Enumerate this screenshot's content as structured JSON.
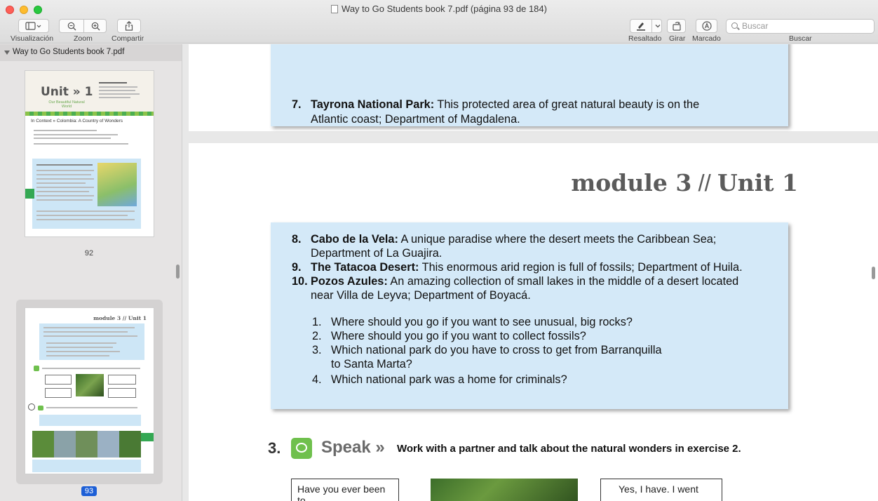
{
  "window": {
    "title": "Way to Go Students book  7.pdf (página 93 de 184)"
  },
  "toolbar": {
    "visualizacion_label": "Visualización",
    "zoom_label": "Zoom",
    "compartir_label": "Compartir",
    "resaltado_label": "Resaltado",
    "girar_label": "Girar",
    "marcado_label": "Marcado",
    "buscar_label": "Buscar",
    "search_placeholder": "Buscar"
  },
  "sidebar": {
    "header": "Way to Go Students book  7.pdf",
    "pages": [
      {
        "number": "92",
        "selected": false,
        "unit_title": "Unit » 1",
        "unit_subtitle": "Our Beautiful Natural World",
        "context": "In Context » Colombia: A Country of Wonders"
      },
      {
        "number": "93",
        "selected": true,
        "module_title": "module 3 // Unit 1"
      }
    ]
  },
  "document": {
    "top_item": {
      "num": "7.",
      "title": "Tayrona National Park:",
      "text": " This protected area of great natural beauty is on the",
      "cont": "Atlantic coast; Department of Magdalena."
    },
    "module_word": "module 3",
    "module_sep": " // ",
    "module_unit": "Unit 1",
    "items": [
      {
        "num": "8.",
        "title": "Cabo de la Vela:",
        "text": " A unique paradise where the desert meets the Caribbean Sea;",
        "cont": "Department of La Guajira."
      },
      {
        "num": "9.",
        "title": "The Tatacoa Desert:",
        "text": " This enormous arid region is full of fossils; Department of Huila."
      },
      {
        "num": "10.",
        "title": "Pozos Azules:",
        "text": " An amazing collection of small lakes in the middle of a desert located",
        "cont": "near Villa de Leyva; Department of Boyacá."
      }
    ],
    "questions": [
      {
        "num": "1.",
        "text": "Where should you go if you want to see unusual, big rocks?"
      },
      {
        "num": "2.",
        "text": "Where should you go if you want to collect fossils?"
      },
      {
        "num": "3.",
        "text": "Which national park do you have to cross to get from Barranquilla",
        "cont": "to Santa Marta?"
      },
      {
        "num": "4.",
        "text": "Which national park was a home for criminals?"
      }
    ],
    "speak": {
      "number": "3.",
      "word": "Speak",
      "arrows": "»",
      "instruction": "Work with a partner and talk about the natural wonders in exercise 2."
    },
    "bubble_left": "Have you ever been to",
    "bubble_right": "Yes, I have. I went"
  }
}
